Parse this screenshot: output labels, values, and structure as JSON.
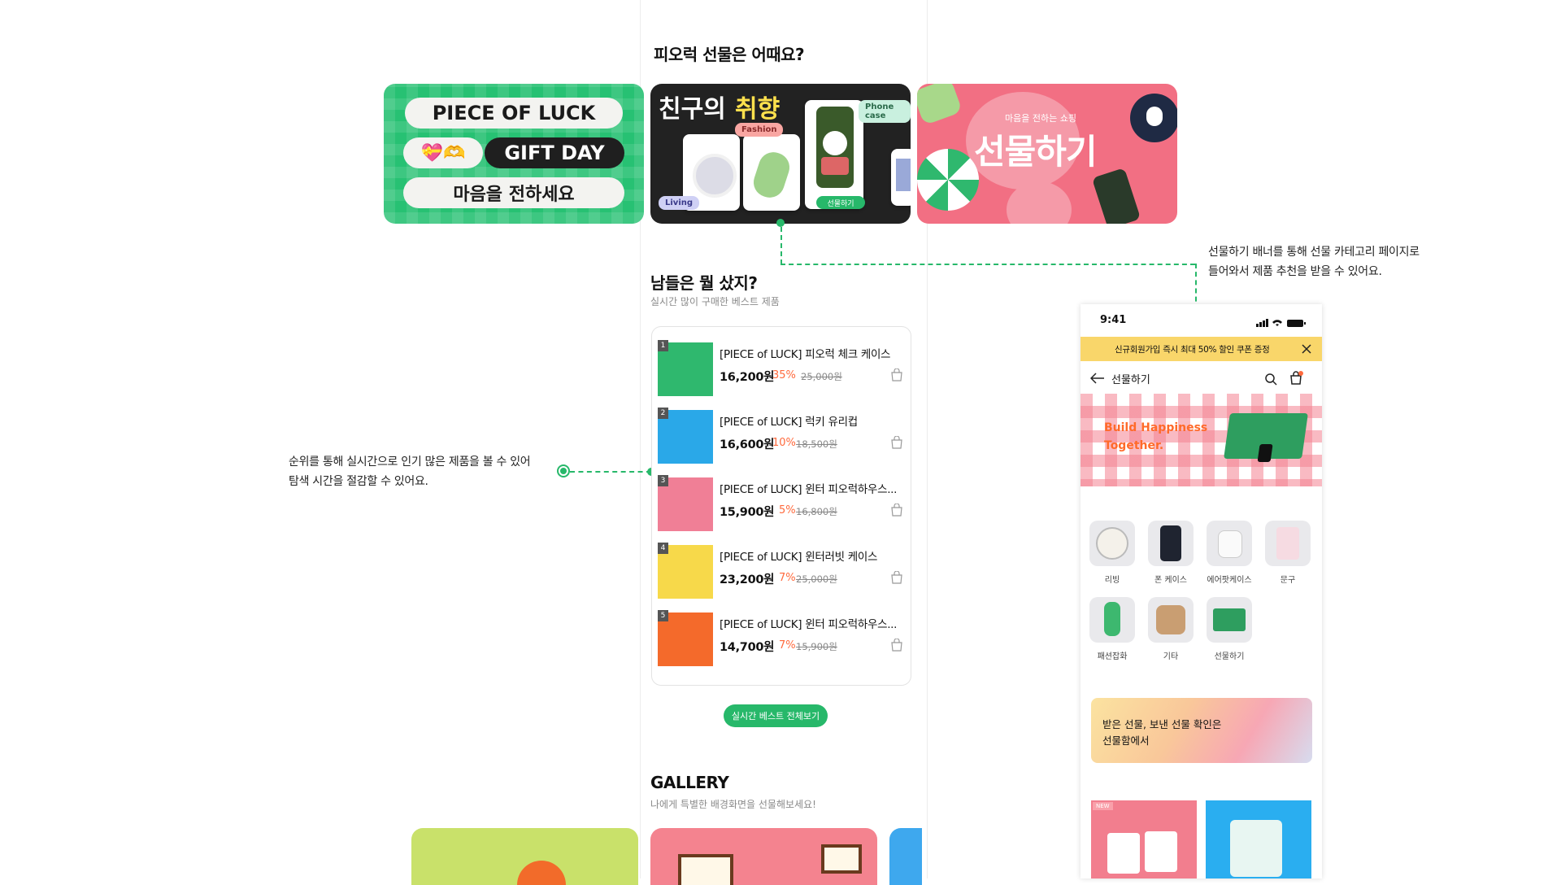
{
  "section_gift": {
    "title": "피오럭 선물은 어때요?"
  },
  "banner1": {
    "line1": "PIECE OF LUCK",
    "line2": "GIFT DAY",
    "line3": "마음을 전하세요",
    "emoji": "💝🫶"
  },
  "banner2": {
    "title_a": "친구의",
    "title_b": "취향",
    "tags": [
      "Fashion",
      "Phone case",
      "Living"
    ],
    "button": "선물하기"
  },
  "banner3": {
    "sub": "마음을 전하는 쇼핑",
    "title": "선물하기"
  },
  "annotation_right": {
    "line1": "선물하기 배너를 통해 선물 카테고리 페이지로",
    "line2": "들어와서 제품 추천을 받을 수 있어요."
  },
  "annotation_left": {
    "line1": "순위를 통해 실시간으로 인기 많은 제품을 볼 수 있어",
    "line2": "탐색 시간을 절감할 수 있어요."
  },
  "section_best": {
    "title": "남들은 뭘 샀지?",
    "subtitle": "실시간 많이 구매한 베스트 제품"
  },
  "best_items": [
    {
      "rank": "1",
      "name": "[PIECE of LUCK] 피오럭 체크 케이스",
      "price": "16,200원",
      "discount": "35%",
      "original": "25,000원",
      "thumb_color": "#2fb86e"
    },
    {
      "rank": "2",
      "name": "[PIECE of LUCK] 럭키 유리컵",
      "price": "16,600원",
      "discount": "10%",
      "original": "18,500원",
      "thumb_color": "#2aa8e8"
    },
    {
      "rank": "3",
      "name": "[PIECE of LUCK] 윈터 피오럭하우스...",
      "price": "15,900원",
      "discount": "5%",
      "original": "16,800원",
      "thumb_color": "#f07f96"
    },
    {
      "rank": "4",
      "name": "[PIECE of LUCK] 윈터러빗 케이스",
      "price": "23,200원",
      "discount": "7%",
      "original": "25,000원",
      "thumb_color": "#f7d94a"
    },
    {
      "rank": "5",
      "name": "[PIECE of LUCK] 윈터 피오럭하우스...",
      "price": "14,700원",
      "discount": "7%",
      "original": "15,900원",
      "thumb_color": "#f46a2b"
    }
  ],
  "best_button": "실시간 베스트 전체보기",
  "section_gallery": {
    "title": "GALLERY",
    "subtitle": "나에게 특별한 배경화면을 선물해보세요!"
  },
  "phone": {
    "time": "9:41",
    "promo": "신규회원가입 즉시 최대 50% 할인 쿠폰 증정",
    "nav_title": "선물하기",
    "hero_text_1": "Build Happiness",
    "hero_text_2": "Together.",
    "categories": [
      {
        "label": "리빙",
        "color": "#d9d9dc"
      },
      {
        "label": "폰 케이스",
        "color": "#1f2430"
      },
      {
        "label": "에어팟케이스",
        "color": "#eef0f5"
      },
      {
        "label": "문구",
        "color": "#f5e3e8"
      },
      {
        "label": "패션잡화",
        "color": "#3db86f"
      },
      {
        "label": "기타",
        "color": "#c99e72"
      },
      {
        "label": "선물하기",
        "color": "#2e9e5f"
      }
    ],
    "gift_box_line1": "받은 선물, 보낸 선물 확인은",
    "gift_box_line2": "선물함에서",
    "new_badge": "NEW"
  },
  "colors": {
    "brand_green": "#27b86a",
    "discount": "#ff6a3d",
    "promo_bg": "#f9d66a"
  }
}
